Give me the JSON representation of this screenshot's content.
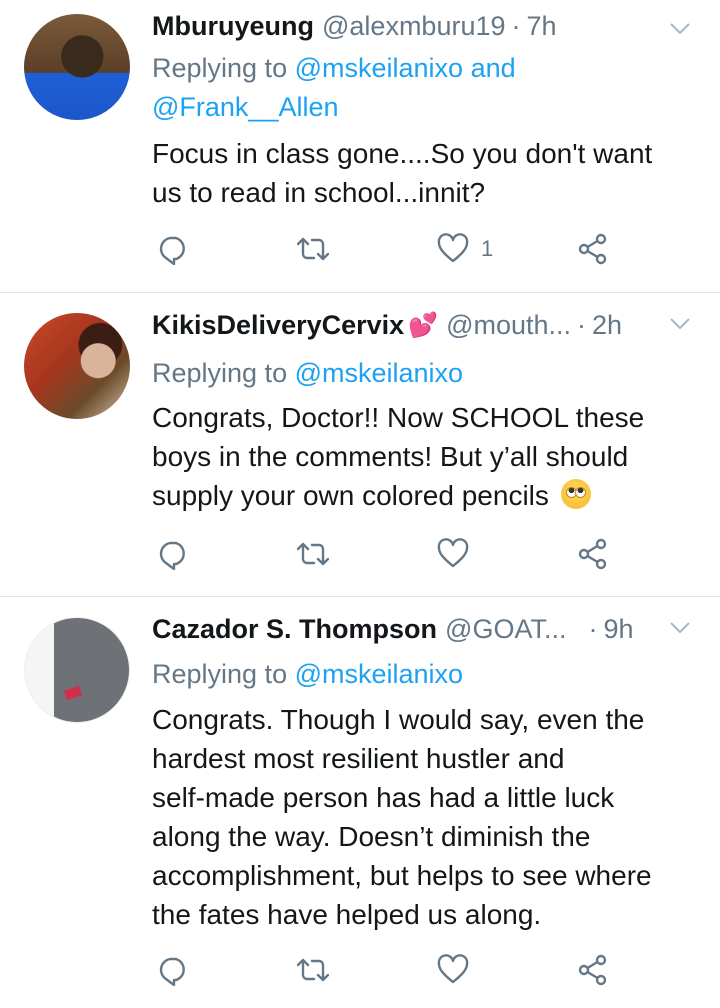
{
  "tweets": [
    {
      "name": "Mburuyeung",
      "handle": "@alexmburu19",
      "dot": "·",
      "time": "7h",
      "replying_prefix": "Replying to ",
      "replying_to": "@mskeilanixo",
      "replying_and": " and",
      "replying_to_2": "@Frank__Allen",
      "body_lines": [
        "Focus in class gone....So you don't want",
        "us to read in school...innit?"
      ],
      "like_count": "1"
    },
    {
      "name": "KikisDeliveryCervix",
      "name_emoji": "💕",
      "handle": "@mouth...",
      "dot": "·",
      "time": "2h",
      "replying_prefix": "Replying to ",
      "replying_to": "@mskeilanixo",
      "body_lines": [
        "Congrats, Doctor!! Now SCHOOL these",
        "boys in the comments! But y’all should",
        "supply your own colored pencils"
      ],
      "body_emoji": "rolling-eyes-emoji",
      "like_count": ""
    },
    {
      "name": "Cazador S. Thompson",
      "handle": "@GOAT...",
      "dot": "·",
      "time": "9h",
      "replying_prefix": "Replying to ",
      "replying_to": "@mskeilanixo",
      "body_lines": [
        "Congrats.  Though I would say, even the",
        "hardest most resilient hustler and",
        "self-made person has had a little luck",
        "along the way.  Doesn’t diminish the",
        "accomplishment, but helps to see where",
        "the fates have helped us along."
      ],
      "like_count": ""
    }
  ],
  "icons": {
    "reply": "reply-icon",
    "retweet": "retweet-icon",
    "like": "heart-icon",
    "share": "share-icon",
    "more": "chevron-down-icon"
  },
  "colors": {
    "link": "#1da1f2",
    "muted": "#657786",
    "text": "#14171a",
    "divider": "#e1e8ed"
  }
}
